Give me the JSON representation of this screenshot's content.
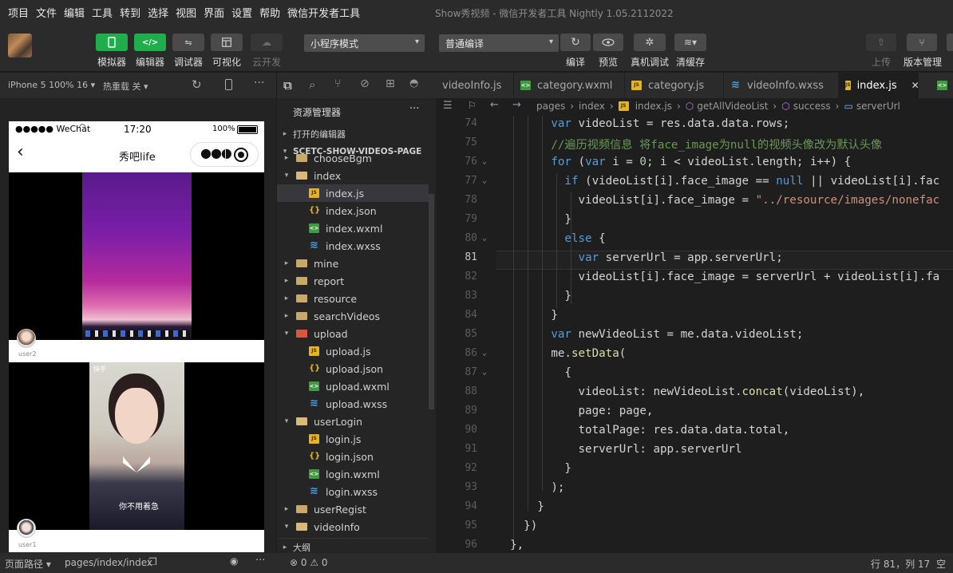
{
  "menu": [
    "项目",
    "文件",
    "编辑",
    "工具",
    "转到",
    "选择",
    "视图",
    "界面",
    "设置",
    "帮助",
    "微信开发者工具"
  ],
  "window_title": "Show秀视频 - 微信开发者工具 Nightly 1.05.2112022",
  "toolbar": {
    "simulator": "模拟器",
    "editor": "编辑器",
    "debugger": "调试器",
    "visual": "可视化",
    "cloud": "云开发",
    "mode_select": "小程序模式",
    "compile_select": "普通编译",
    "compile": "编译",
    "preview": "预览",
    "real_debug": "真机调试",
    "clear_cache": "清缓存",
    "upload": "上传",
    "version": "版本管理"
  },
  "simulator": {
    "device": "iPhone 5 100% 16",
    "hot_reload": "热重载 关",
    "carrier": "●●●●● WeChat",
    "time": "17:20",
    "battery": "100%",
    "nav_title": "秀吧life",
    "video1_user": "user2",
    "video2_caption": "你不用着急",
    "video2_user": "user1",
    "video2_tag": "快手"
  },
  "explorer": {
    "title": "资源管理器",
    "open_editors": "打开的编辑器",
    "project": "SCETC-SHOW-VIDEOS-PAGE",
    "outline": "大纲",
    "items": [
      {
        "name": "chooseBgm",
        "type": "folder",
        "depth": 1,
        "open": false
      },
      {
        "name": "index",
        "type": "folder",
        "depth": 1,
        "open": true
      },
      {
        "name": "index.js",
        "type": "js",
        "depth": 2,
        "selected": true
      },
      {
        "name": "index.json",
        "type": "json",
        "depth": 2
      },
      {
        "name": "index.wxml",
        "type": "wxml",
        "depth": 2
      },
      {
        "name": "index.wxss",
        "type": "wxss",
        "depth": 2
      },
      {
        "name": "mine",
        "type": "folder",
        "depth": 1,
        "open": false
      },
      {
        "name": "report",
        "type": "folder",
        "depth": 1,
        "open": false
      },
      {
        "name": "resource",
        "type": "folder",
        "depth": 1,
        "open": false
      },
      {
        "name": "searchVideos",
        "type": "folder",
        "depth": 1,
        "open": false
      },
      {
        "name": "upload",
        "type": "folder-red",
        "depth": 1,
        "open": true
      },
      {
        "name": "upload.js",
        "type": "js",
        "depth": 2
      },
      {
        "name": "upload.json",
        "type": "json",
        "depth": 2
      },
      {
        "name": "upload.wxml",
        "type": "wxml",
        "depth": 2
      },
      {
        "name": "upload.wxss",
        "type": "wxss",
        "depth": 2
      },
      {
        "name": "userLogin",
        "type": "folder",
        "depth": 1,
        "open": true
      },
      {
        "name": "login.js",
        "type": "js",
        "depth": 2
      },
      {
        "name": "login.json",
        "type": "json",
        "depth": 2
      },
      {
        "name": "login.wxml",
        "type": "wxml",
        "depth": 2
      },
      {
        "name": "login.wxss",
        "type": "wxss",
        "depth": 2
      },
      {
        "name": "userRegist",
        "type": "folder",
        "depth": 1,
        "open": false
      },
      {
        "name": "videoInfo",
        "type": "folder",
        "depth": 1,
        "open": true
      }
    ]
  },
  "tabs": [
    {
      "label": "videoInfo.js",
      "type": "js"
    },
    {
      "label": "category.wxml",
      "type": "wxml"
    },
    {
      "label": "category.js",
      "type": "js"
    },
    {
      "label": "videoInfo.wxss",
      "type": "wxss"
    },
    {
      "label": "index.js",
      "type": "js",
      "active": true
    }
  ],
  "breadcrumbs": [
    "pages",
    "index",
    "index.js",
    "getAllVideoList",
    "success",
    "serverUrl"
  ],
  "code_lines": [
    {
      "n": 74,
      "f": "",
      "html": "        <span class='kw'>var</span> videoList = res.data.data.rows;"
    },
    {
      "n": 75,
      "f": "",
      "html": "        <span class='cm'>//遍历视频信息 将face_image为null的视频头像改为默认头像</span>"
    },
    {
      "n": 76,
      "f": "v",
      "html": "        <span class='kw'>for</span> (<span class='kw'>var</span> i = <span class='nm'>0</span>; i &lt; videoList.length; i++) {"
    },
    {
      "n": 77,
      "f": "v",
      "html": "          <span class='kw'>if</span> (videoList[i].face_image == <span class='kw'>null</span> || videoList[i].fac"
    },
    {
      "n": 78,
      "f": "",
      "html": "            videoList[i].face_image = <span class='st'>\"../resource/images/nonefac</span>"
    },
    {
      "n": 79,
      "f": "",
      "html": "          }"
    },
    {
      "n": 80,
      "f": "v",
      "html": "          <span class='kw'>else</span> {"
    },
    {
      "n": 81,
      "f": "",
      "html": "            <span class='kw'>var</span> serverUrl = app.serverUrl;",
      "cur": true
    },
    {
      "n": 82,
      "f": "",
      "html": "            videoList[i].face_image = serverUrl + videoList[i].fa"
    },
    {
      "n": 83,
      "f": "",
      "html": "          }"
    },
    {
      "n": 84,
      "f": "",
      "html": "        }"
    },
    {
      "n": 85,
      "f": "",
      "html": "        <span class='kw'>var</span> newVideoList = me.data.videoList;"
    },
    {
      "n": 86,
      "f": "v",
      "html": "        me.<span class='fn'>setData</span>("
    },
    {
      "n": 87,
      "f": "v",
      "html": "          {"
    },
    {
      "n": 88,
      "f": "",
      "html": "            videoList: newVideoList.<span class='fn'>concat</span>(videoList),"
    },
    {
      "n": 89,
      "f": "",
      "html": "            page: page,"
    },
    {
      "n": 90,
      "f": "",
      "html": "            totalPage: res.data.data.total,"
    },
    {
      "n": 91,
      "f": "",
      "html": "            serverUrl: app.serverUrl"
    },
    {
      "n": 92,
      "f": "",
      "html": "          }"
    },
    {
      "n": 93,
      "f": "",
      "html": "        );"
    },
    {
      "n": 94,
      "f": "",
      "html": "      }"
    },
    {
      "n": 95,
      "f": "",
      "html": "    })"
    },
    {
      "n": 96,
      "f": "",
      "html": "  },"
    }
  ],
  "statusbar": {
    "page_path_label": "页面路径",
    "page_path": "pages/index/index",
    "problems": "⊗ 0 ⚠ 0",
    "cursor": "行 81，列 17",
    "spaces": "空格"
  },
  "colors": {
    "accent": "#1fae4c",
    "bg": "#1e1e1e",
    "panel": "#2b2b2b",
    "keyword": "#569cd6",
    "comment": "#6a9955",
    "string": "#ce9178"
  }
}
